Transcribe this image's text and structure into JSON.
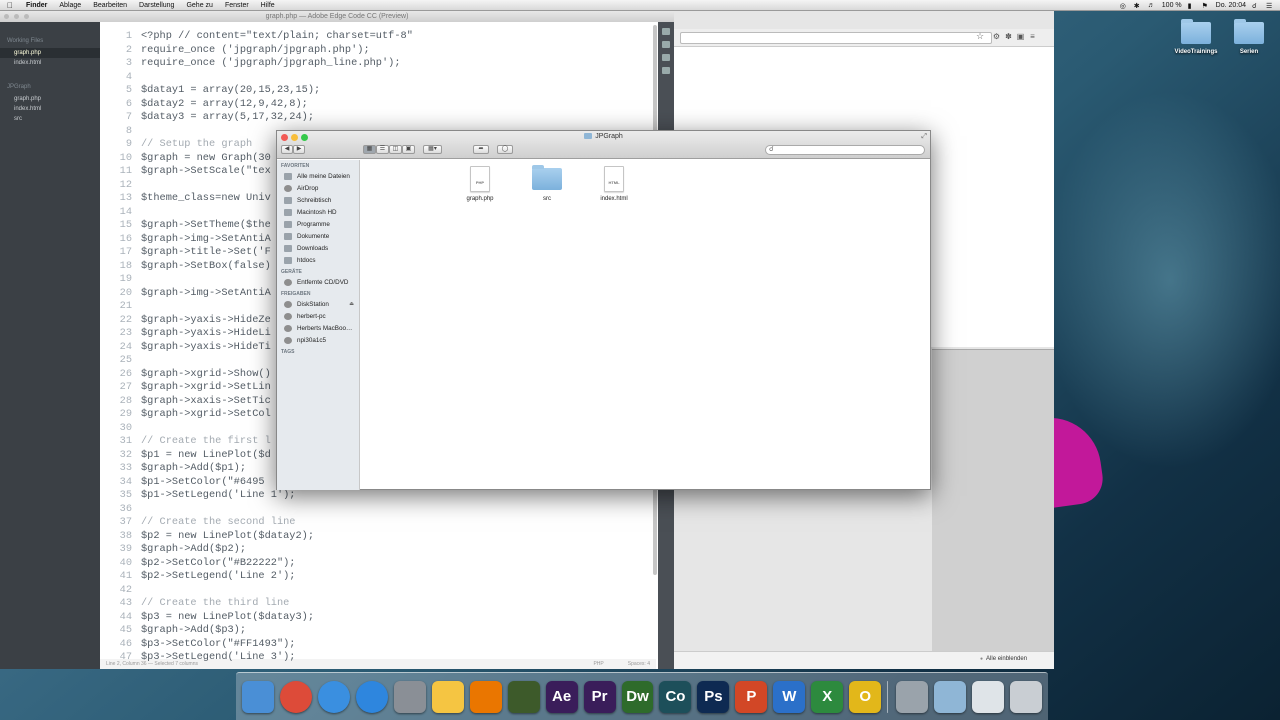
{
  "menubar": {
    "app": "Finder",
    "items": [
      "Ablage",
      "Bearbeiten",
      "Darstellung",
      "Gehe zu",
      "Fenster",
      "Hilfe"
    ],
    "battery": "100 %",
    "clock": "Do. 20:04"
  },
  "editor": {
    "window_title": "graph.php — Adobe Edge Code CC (Preview)",
    "sidebar": {
      "working_files_header": "Working Files",
      "working_files": [
        "graph.php",
        "index.html"
      ],
      "project_header": "JPGraph",
      "project_files": [
        "graph.php",
        "index.html",
        "src"
      ]
    },
    "code_lines": [
      {
        "n": "1",
        "t": "<?php // content=\"text/plain; charset=utf-8\""
      },
      {
        "n": "2",
        "t": "require_once ('jpgraph/jpgraph.php');"
      },
      {
        "n": "3",
        "t": "require_once ('jpgraph/jpgraph_line.php');"
      },
      {
        "n": "4",
        "t": ""
      },
      {
        "n": "5",
        "t": "$datay1 = array(20,15,23,15);"
      },
      {
        "n": "6",
        "t": "$datay2 = array(12,9,42,8);"
      },
      {
        "n": "7",
        "t": "$datay3 = array(5,17,32,24);"
      },
      {
        "n": "8",
        "t": ""
      },
      {
        "n": "9",
        "t": "// Setup the graph"
      },
      {
        "n": "10",
        "t": "$graph = new Graph(30"
      },
      {
        "n": "11",
        "t": "$graph->SetScale(\"tex"
      },
      {
        "n": "12",
        "t": ""
      },
      {
        "n": "13",
        "t": "$theme_class=new Univ"
      },
      {
        "n": "14",
        "t": ""
      },
      {
        "n": "15",
        "t": "$graph->SetTheme($the"
      },
      {
        "n": "16",
        "t": "$graph->img->SetAntiA"
      },
      {
        "n": "17",
        "t": "$graph->title->Set('F"
      },
      {
        "n": "18",
        "t": "$graph->SetBox(false)"
      },
      {
        "n": "19",
        "t": ""
      },
      {
        "n": "20",
        "t": "$graph->img->SetAntiA"
      },
      {
        "n": "21",
        "t": ""
      },
      {
        "n": "22",
        "t": "$graph->yaxis->HideZe"
      },
      {
        "n": "23",
        "t": "$graph->yaxis->HideLi"
      },
      {
        "n": "24",
        "t": "$graph->yaxis->HideTi"
      },
      {
        "n": "25",
        "t": ""
      },
      {
        "n": "26",
        "t": "$graph->xgrid->Show()"
      },
      {
        "n": "27",
        "t": "$graph->xgrid->SetLin"
      },
      {
        "n": "28",
        "t": "$graph->xaxis->SetTic"
      },
      {
        "n": "29",
        "t": "$graph->xgrid->SetCol"
      },
      {
        "n": "30",
        "t": ""
      },
      {
        "n": "31",
        "t": "// Create the first l"
      },
      {
        "n": "32",
        "t": "$p1 = new LinePlot($d"
      },
      {
        "n": "33",
        "t": "$graph->Add($p1);"
      },
      {
        "n": "34",
        "t": "$p1->SetColor(\"#6495"
      },
      {
        "n": "35",
        "t": "$p1->SetLegend('Line 1');"
      },
      {
        "n": "36",
        "t": ""
      },
      {
        "n": "37",
        "t": "// Create the second line"
      },
      {
        "n": "38",
        "t": "$p2 = new LinePlot($datay2);"
      },
      {
        "n": "39",
        "t": "$graph->Add($p2);"
      },
      {
        "n": "40",
        "t": "$p2->SetColor(\"#B22222\");"
      },
      {
        "n": "41",
        "t": "$p2->SetLegend('Line 2');"
      },
      {
        "n": "42",
        "t": ""
      },
      {
        "n": "43",
        "t": "// Create the third line"
      },
      {
        "n": "44",
        "t": "$p3 = new LinePlot($datay3);"
      },
      {
        "n": "45",
        "t": "$graph->Add($p3);"
      },
      {
        "n": "46",
        "t": "$p3->SetColor(\"#FF1493\");"
      },
      {
        "n": "47",
        "t": "$p3->SetLegend('Line 3');"
      }
    ],
    "status_left": "Line 2, Column 36 — Selected 7 columns",
    "status_lang": "PHP",
    "status_spaces": "Spaces: 4"
  },
  "browser": {
    "bottom_label": "Alle einblenden"
  },
  "finder": {
    "title": "JPGraph",
    "sidebar": [
      {
        "section": "FAVORITEN",
        "items": [
          "Alle meine Dateien",
          "AirDrop",
          "Schreibtisch",
          "Macintosh HD",
          "Programme",
          "Dokumente",
          "Downloads",
          "htdocs"
        ]
      },
      {
        "section": "GERÄTE",
        "items": [
          "Entfernte CD/DVD"
        ]
      },
      {
        "section": "FREIGABEN",
        "items": [
          "DiskStation",
          "herbert-pc",
          "Herberts MacBoo…",
          "npi30a1c5"
        ]
      },
      {
        "section": "TAGS",
        "items": []
      }
    ],
    "files": [
      {
        "name": "graph.php",
        "kind": "php-document",
        "tag": "PHP"
      },
      {
        "name": "src",
        "kind": "folder",
        "tag": ""
      },
      {
        "name": "index.html",
        "kind": "html-document",
        "tag": "HTML"
      }
    ]
  },
  "desktop": {
    "icons": [
      "VideoTrainings",
      "Serien"
    ]
  },
  "dock": {
    "apps": [
      {
        "name": "finder-icon",
        "label": "",
        "color": "#4a8fd6"
      },
      {
        "name": "chrome-icon",
        "label": "",
        "color": "#dd4b39"
      },
      {
        "name": "itunes-icon",
        "label": "",
        "color": "#3a8fe0"
      },
      {
        "name": "app-store-icon",
        "label": "",
        "color": "#2e86de"
      },
      {
        "name": "system-preferences-icon",
        "label": "",
        "color": "#8a8f96"
      },
      {
        "name": "python-icon",
        "label": "",
        "color": "#f5c542"
      },
      {
        "name": "blender-icon",
        "label": "",
        "color": "#ea7600"
      },
      {
        "name": "terminal-icon",
        "label": "",
        "color": "#3d5a2a"
      },
      {
        "name": "after-effects-icon",
        "label": "Ae",
        "color": "#3a1d5a"
      },
      {
        "name": "premiere-icon",
        "label": "Pr",
        "color": "#3a1d5a"
      },
      {
        "name": "dreamweaver-icon",
        "label": "Dw",
        "color": "#2e6b2b"
      },
      {
        "name": "edge-code-icon",
        "label": "Co",
        "color": "#1d4f5a"
      },
      {
        "name": "photoshop-icon",
        "label": "Ps",
        "color": "#0e2a52"
      },
      {
        "name": "powerpoint-icon",
        "label": "P",
        "color": "#d24726"
      },
      {
        "name": "word-icon",
        "label": "W",
        "color": "#2b70c9"
      },
      {
        "name": "excel-icon",
        "label": "X",
        "color": "#2d8a3e"
      },
      {
        "name": "outlook-icon",
        "label": "O",
        "color": "#e2b71a"
      },
      {
        "name": "disk-utility-icon",
        "label": "",
        "color": "#9aa3ab"
      },
      {
        "name": "downloads-stack-icon",
        "label": "",
        "color": "#8fb6d6"
      },
      {
        "name": "documents-stack-icon",
        "label": "",
        "color": "#dfe4e8"
      },
      {
        "name": "trash-icon",
        "label": "",
        "color": "#c9ced3"
      }
    ]
  }
}
